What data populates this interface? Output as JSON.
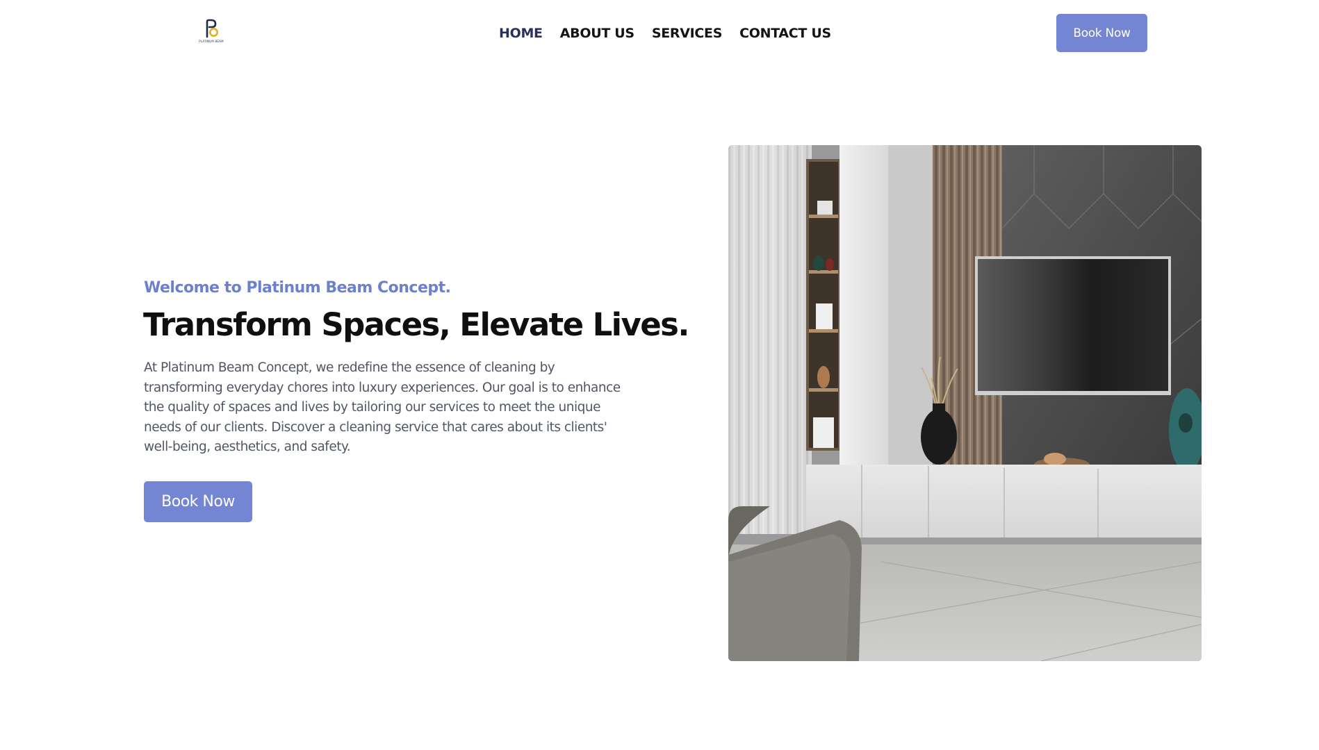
{
  "header": {
    "logo": {
      "icon": "pb-monogram-icon",
      "wordmark": "PLATINUM BEAM"
    },
    "nav": [
      {
        "label": "HOME",
        "active": true
      },
      {
        "label": "ABOUT US",
        "active": false
      },
      {
        "label": "SERVICES",
        "active": false
      },
      {
        "label": "CONTACT US",
        "active": false
      }
    ],
    "book_label": "Book Now"
  },
  "hero": {
    "eyebrow": "Welcome to Platinum Beam Concept.",
    "headline": "Transform Spaces, Elevate Lives.",
    "description": "At Platinum Beam Concept, we redefine the essence of cleaning by transforming everyday chores into luxury experiences. Our goal is to enhance the quality of spaces and lives by tailoring our services to meet the unique needs of our clients. Discover a cleaning service that cares about its clients' well-being, aesthetics, and safety.",
    "cta_label": "Book Now",
    "image": "living-room-tv-wall-photo"
  },
  "colors": {
    "accent": "#7485d3",
    "eyebrow": "#6c80cf",
    "nav_active": "#2a2f5c",
    "heading": "#0f0f0f",
    "body_text": "#505664"
  }
}
